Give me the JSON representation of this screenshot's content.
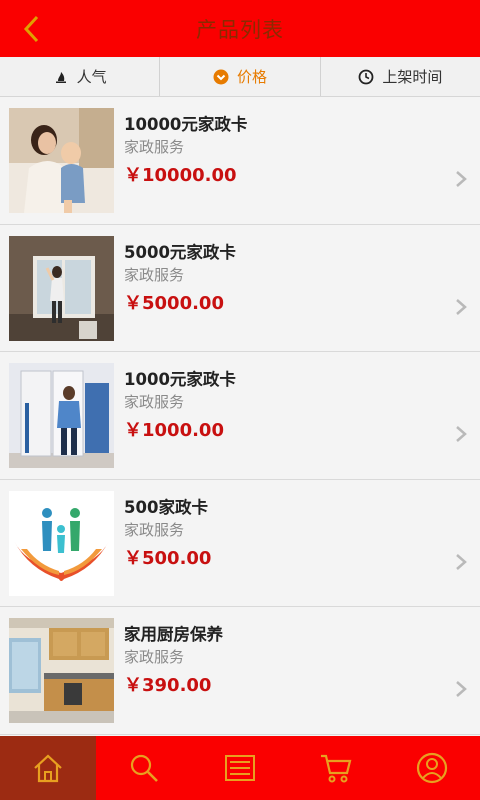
{
  "header": {
    "title": "产品列表"
  },
  "sort": {
    "tabs": [
      {
        "label": "人气",
        "icon": "popularity-icon"
      },
      {
        "label": "价格",
        "icon": "price-icon",
        "active": true
      },
      {
        "label": "上架时间",
        "icon": "clock-icon"
      }
    ]
  },
  "products": [
    {
      "name": "10000元家政卡",
      "category": "家政服务",
      "price": "￥10000.00"
    },
    {
      "name": "5000元家政卡",
      "category": "家政服务",
      "price": "￥5000.00"
    },
    {
      "name": "1000元家政卡",
      "category": "家政服务",
      "price": "￥1000.00"
    },
    {
      "name": "500家政卡",
      "category": "家政服务",
      "price": "￥500.00"
    },
    {
      "name": "家用厨房保养",
      "category": "家政服务",
      "price": "￥390.00"
    }
  ],
  "tabbar": {
    "items": [
      {
        "icon": "home-icon",
        "active": true
      },
      {
        "icon": "search-icon"
      },
      {
        "icon": "list-icon"
      },
      {
        "icon": "cart-icon"
      },
      {
        "icon": "user-icon"
      }
    ]
  },
  "colors": {
    "accent": "#fa0000",
    "price": "#c81010",
    "active_sort": "#e77b00",
    "active_tab": "#9c2b12"
  }
}
